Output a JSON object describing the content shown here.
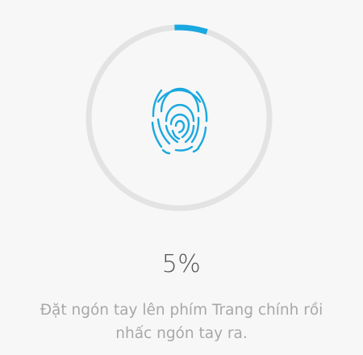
{
  "enrollment": {
    "progress_percent": 5,
    "progress_label": "5%",
    "instruction": "Đặt ngón tay lên phím Trang chính rồi nhấc ngón tay ra."
  },
  "icons": {
    "center": "fingerprint-icon"
  },
  "colors": {
    "background": "#f7f7f7",
    "ring_track": "#e3e3e3",
    "ring_progress": "#1aa8e0",
    "fingerprint": "#1aa8e0",
    "percent_text": "#555555",
    "instruction_text": "#a8a8a8"
  }
}
